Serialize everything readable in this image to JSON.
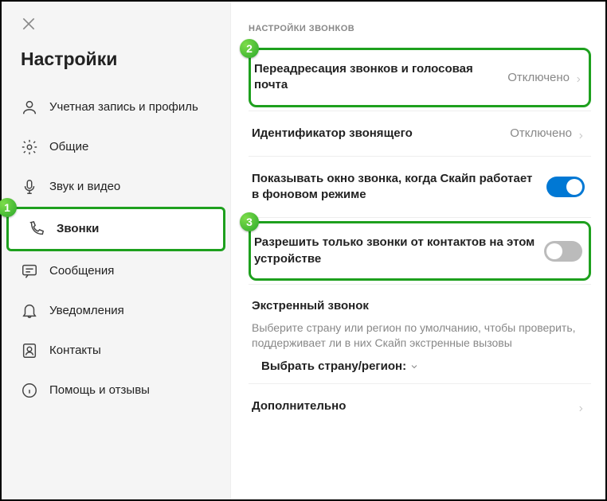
{
  "sidebar": {
    "title": "Настройки",
    "items": [
      {
        "label": "Учетная запись и профиль"
      },
      {
        "label": "Общие"
      },
      {
        "label": "Звук и видео"
      },
      {
        "label": "Звонки"
      },
      {
        "label": "Сообщения"
      },
      {
        "label": "Уведомления"
      },
      {
        "label": "Контакты"
      },
      {
        "label": "Помощь и отзывы"
      }
    ]
  },
  "content": {
    "section_title": "НАСТРОЙКИ ЗВОНКОВ",
    "forwarding": {
      "label": "Переадресация звонков и голосовая почта",
      "status": "Отключено"
    },
    "caller_id": {
      "label": "Идентификатор звонящего",
      "status": "Отключено"
    },
    "show_window": {
      "label": "Показывать окно звонка, когда Скайп работает в фоновом режиме",
      "on": true
    },
    "contacts_only": {
      "label": "Разрешить только звонки от контактов на этом устройстве",
      "on": false
    },
    "emergency": {
      "title": "Экстренный звонок",
      "desc": "Выберите страну или регион по умолчанию, чтобы проверить, поддерживает ли в них Скайп экстренные вызовы",
      "select": "Выбрать страну/регион:"
    },
    "more": "Дополнительно"
  },
  "badges": {
    "b1": "1",
    "b2": "2",
    "b3": "3"
  }
}
